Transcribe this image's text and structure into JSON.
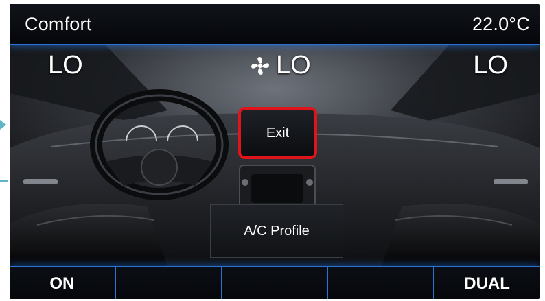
{
  "status_bar": {
    "mode": "Comfort",
    "temperature": "22.0°C"
  },
  "climate": {
    "left_zone": "LO",
    "fan_icon": "fan-icon",
    "fan_speed": "LO",
    "right_zone": "LO"
  },
  "popup": {
    "exit_label": "Exit",
    "profile_label": "A/C Profile",
    "highlight_color": "#e0141b"
  },
  "soft_keys": [
    "ON",
    "",
    "",
    "",
    "DUAL"
  ],
  "colors": {
    "accent": "#2a73d6",
    "pointer": "#5fb6c9"
  }
}
